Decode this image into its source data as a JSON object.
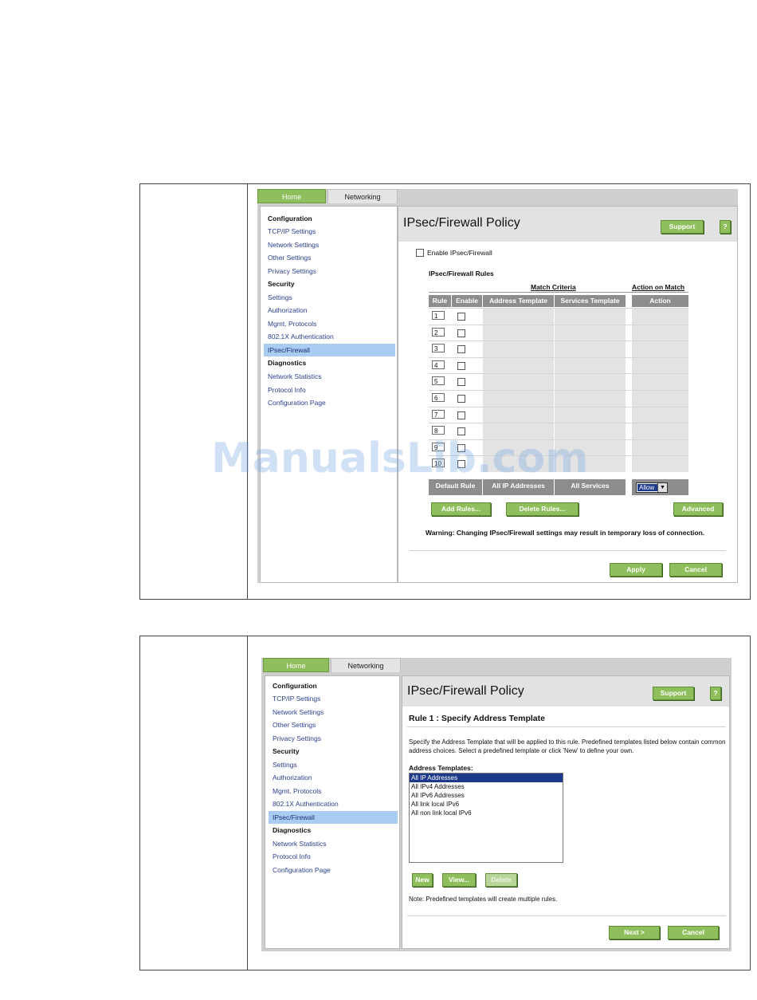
{
  "nav": {
    "tabs": {
      "home": "Home",
      "networking": "Networking"
    },
    "sections": [
      {
        "heading": "Configuration",
        "items": [
          "TCP/IP Settings",
          "Network Settings",
          "Other Settings",
          "Privacy Settings"
        ]
      },
      {
        "heading": "Security",
        "items": [
          "Settings",
          "Authorization",
          "Mgmt. Protocols",
          "802.1X Authentication",
          "IPsec/Firewall"
        ]
      },
      {
        "heading": "Diagnostics",
        "items": [
          "Network Statistics",
          "Protocol Info",
          "Configuration Page"
        ]
      }
    ],
    "selected": "IPsec/Firewall"
  },
  "panel1": {
    "page_title": "IPsec/Firewall Policy",
    "support_label": "Support",
    "help_label": "?",
    "enable_label": "Enable IPsec/Firewall",
    "rules_heading": "IPsec/Firewall Rules",
    "group_headers": {
      "match": "Match Criteria",
      "action": "Action on Match"
    },
    "columns": [
      "Rule",
      "Enable",
      "Address Template",
      "Services Template",
      "Action"
    ],
    "rules": [
      "1",
      "2",
      "3",
      "4",
      "5",
      "6",
      "7",
      "8",
      "9",
      "10"
    ],
    "default_rule": {
      "label": "Default Rule",
      "address": "All IP Addresses",
      "services": "All Services",
      "action": "Allow"
    },
    "buttons": {
      "add": "Add Rules...",
      "delete": "Delete Rules...",
      "advanced": "Advanced",
      "apply": "Apply",
      "cancel": "Cancel"
    },
    "warning": "Warning: Changing IPsec/Firewall settings may result in temporary loss of connection."
  },
  "panel2": {
    "page_title": "IPsec/Firewall Policy",
    "support_label": "Support",
    "help_label": "?",
    "subtitle": "Rule 1 : Specify Address Template",
    "description": "Specify the Address Template that will be applied to this rule. Predefined templates listed below contain common address choices. Select a predefined template or click 'New' to define your own.",
    "list_label": "Address Templates:",
    "templates": [
      "All IP Addresses",
      "All IPv4 Addresses",
      "All IPv6 Addresses",
      "All link local IPv6",
      "All non link local IPv6"
    ],
    "selected_template": "All IP Addresses",
    "buttons": {
      "new": "New",
      "view": "View...",
      "delete": "Delete",
      "next": "Next >",
      "cancel": "Cancel"
    },
    "note": "Note: Predefined templates will create multiple rules."
  },
  "watermark": "ManualsLib.com",
  "colors": {
    "green_button": "#8fbf5c",
    "selected_nav": "#a9cdf2",
    "table_header": "#8d8d8d",
    "list_selection": "#1d3a8a"
  }
}
